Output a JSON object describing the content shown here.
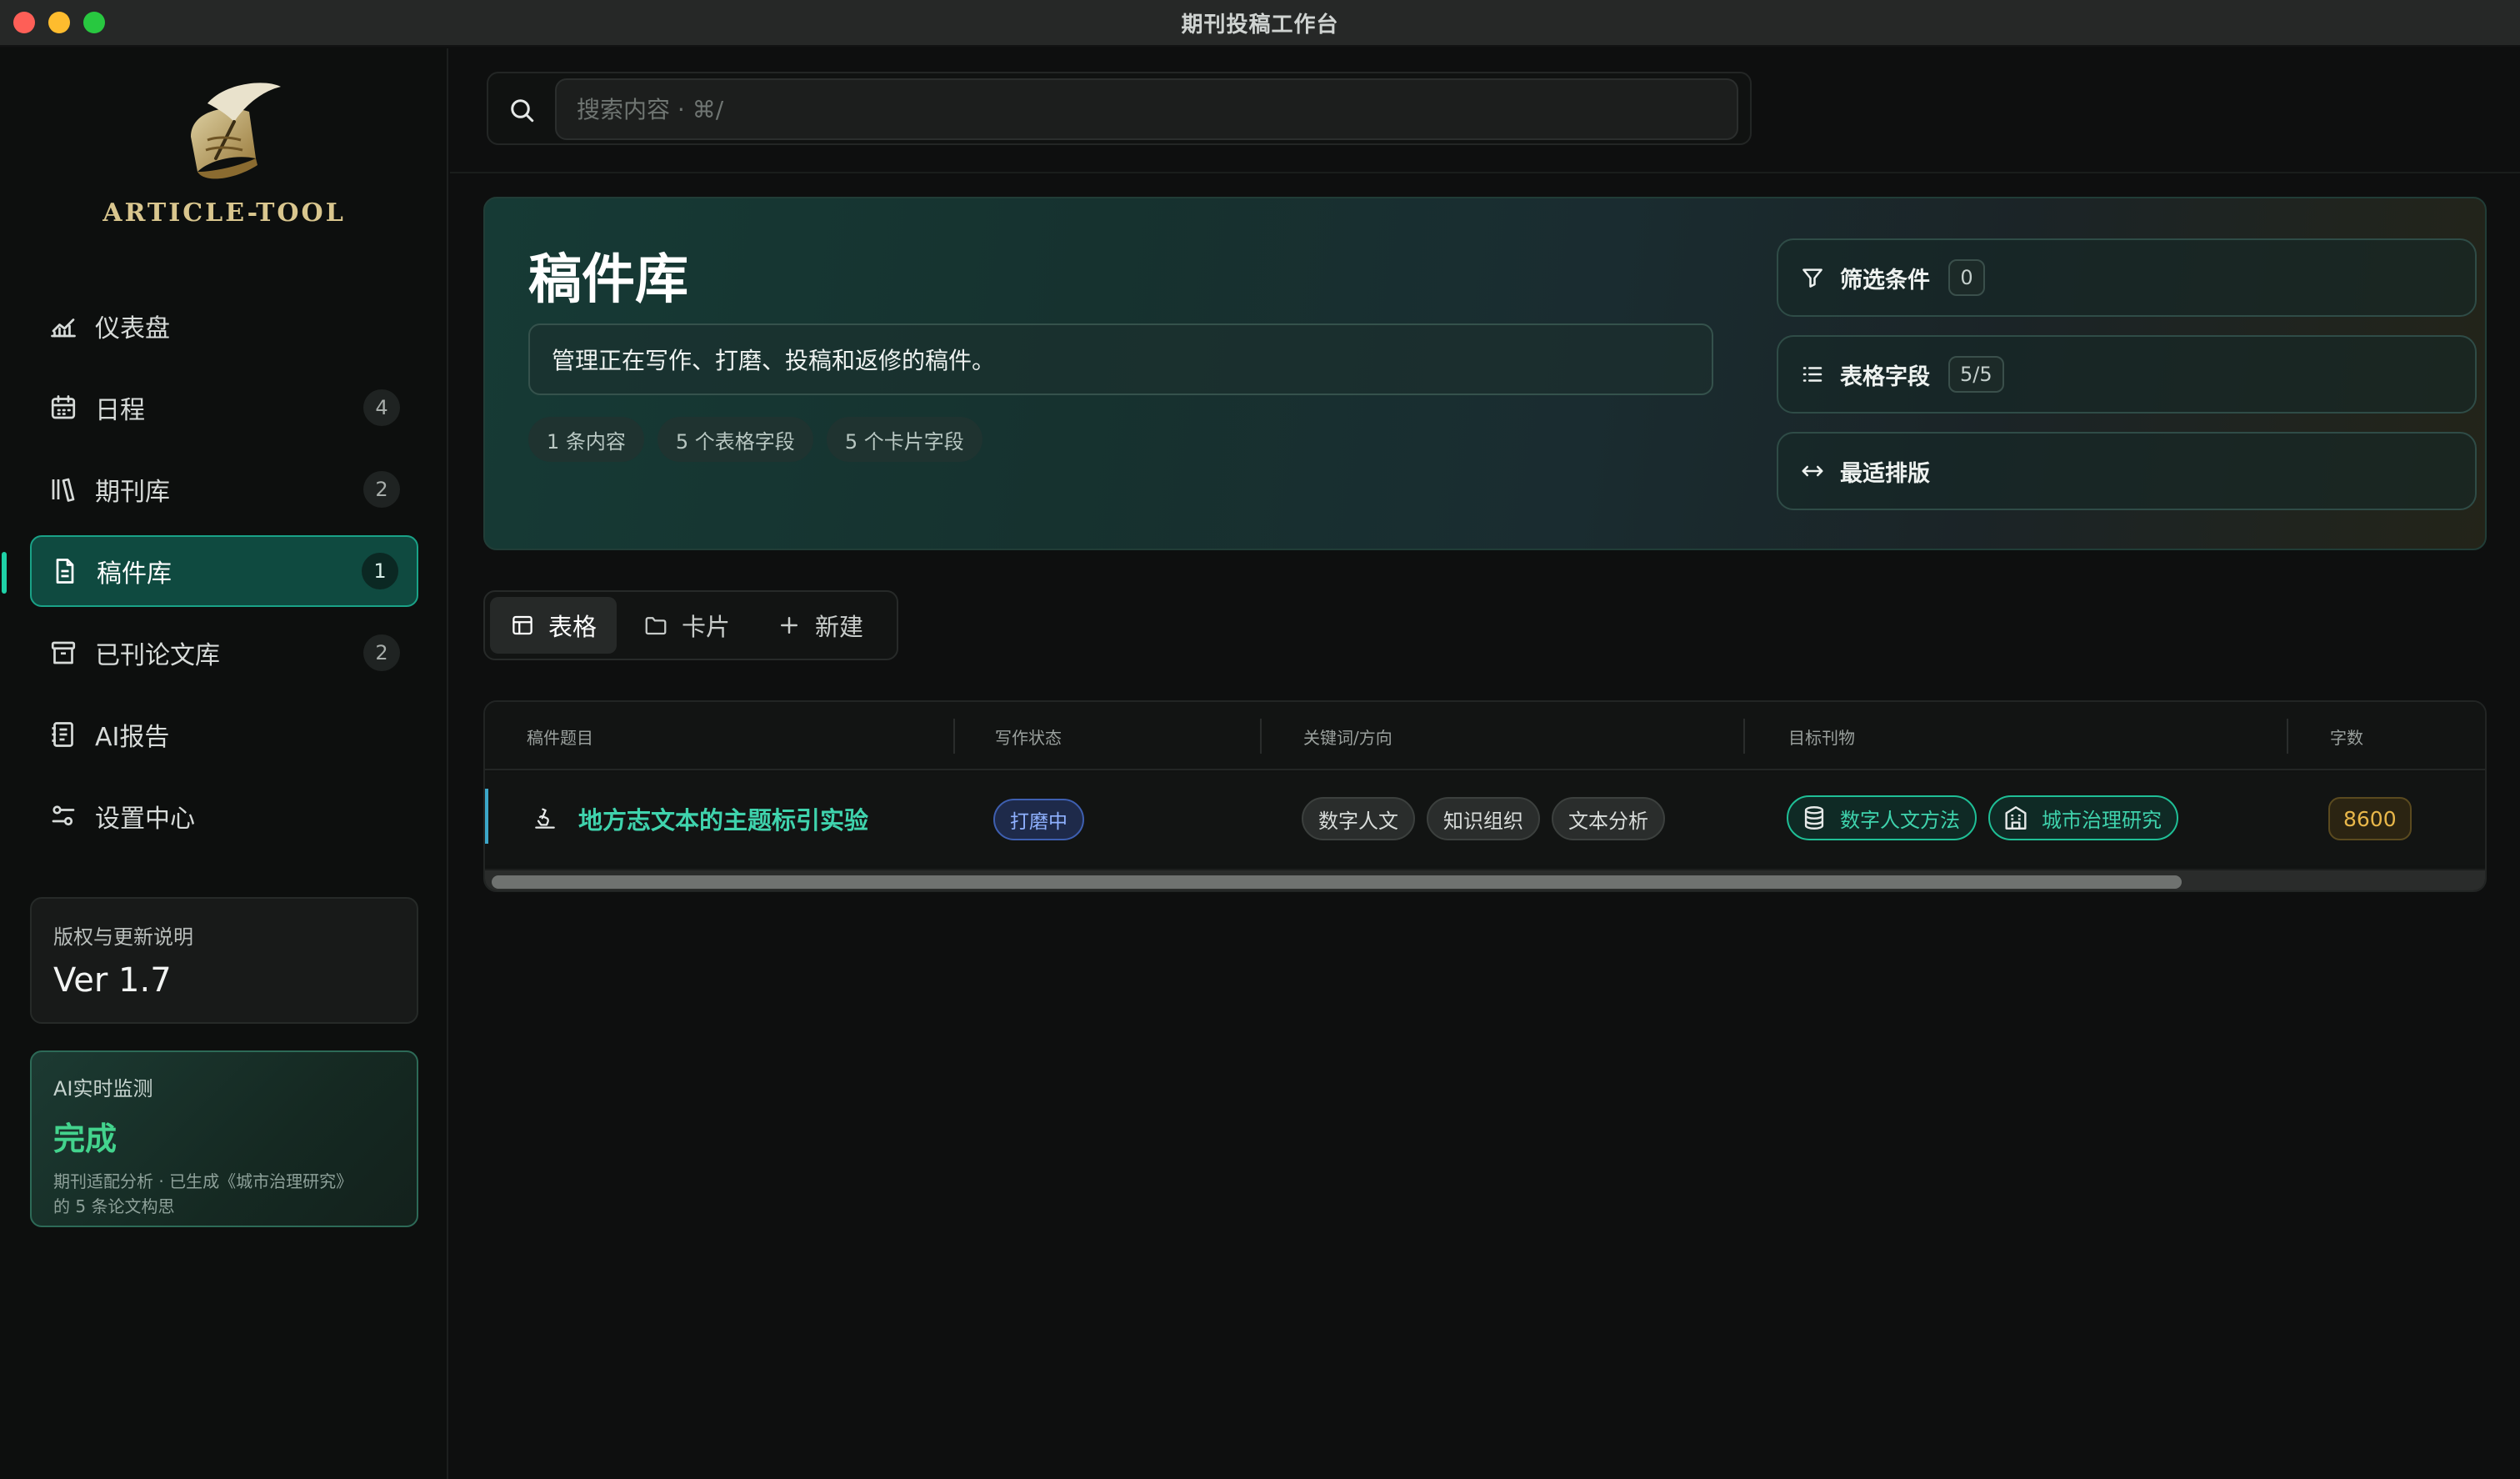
{
  "window": {
    "title": "期刊投稿工作台"
  },
  "brand": {
    "name": "ARTICLE-TOOL"
  },
  "sidebar": {
    "items": [
      {
        "label": "仪表盘",
        "icon": "chart-line-icon",
        "badge": null
      },
      {
        "label": "日程",
        "icon": "calendar-icon",
        "badge": "4"
      },
      {
        "label": "期刊库",
        "icon": "books-icon",
        "badge": "2"
      },
      {
        "label": "稿件库",
        "icon": "document-icon",
        "badge": "1",
        "active": true
      },
      {
        "label": "已刊论文库",
        "icon": "archive-icon",
        "badge": "2"
      },
      {
        "label": "AI报告",
        "icon": "report-icon",
        "badge": null
      },
      {
        "label": "设置中心",
        "icon": "sliders-icon",
        "badge": null
      }
    ],
    "version_card": {
      "caption": "版权与更新说明",
      "value": "Ver 1.7"
    },
    "ai_card": {
      "caption": "AI实时监测",
      "status": "完成",
      "detail_line1": "期刊适配分析 · 已生成《城市治理研究》",
      "detail_line2": "的 5 条论文构思"
    }
  },
  "search": {
    "placeholder": "搜索内容 · ⌘/",
    "value": ""
  },
  "hero": {
    "title": "稿件库",
    "description": "管理正在写作、打磨、投稿和返修的稿件。",
    "stats": [
      "1 条内容",
      "5 个表格字段",
      "5 个卡片字段"
    ],
    "actions": {
      "filter": {
        "label": "筛选条件",
        "count": "0",
        "icon": "filter-icon"
      },
      "fields": {
        "label": "表格字段",
        "count": "5/5",
        "icon": "list-icon"
      },
      "fit": {
        "label": "最适排版",
        "icon": "arrows-horizontal-icon"
      }
    }
  },
  "view_tabs": [
    {
      "label": "表格",
      "icon": "table-icon",
      "active": true
    },
    {
      "label": "卡片",
      "icon": "folder-icon",
      "active": false
    },
    {
      "label": "新建",
      "icon": "plus-icon",
      "active": false
    }
  ],
  "table": {
    "columns": [
      "稿件题目",
      "写作状态",
      "关键词/方向",
      "目标刊物",
      "字数"
    ],
    "rows": [
      {
        "title": "地方志文本的主题标引实验",
        "status": "打磨中",
        "keywords": [
          "数字人文",
          "知识组织",
          "文本分析"
        ],
        "journals": [
          {
            "name": "数字人文方法",
            "icon": "database-icon"
          },
          {
            "name": "城市治理研究",
            "icon": "building-icon"
          }
        ],
        "word_count": "8600"
      }
    ]
  },
  "colors": {
    "accent": "#1fd2a8",
    "active_nav_bg": "#0f4a40",
    "status_blue": "#8fb1ff",
    "word_count_amber": "#e8b74a",
    "ai_done_green": "#43d38d"
  }
}
